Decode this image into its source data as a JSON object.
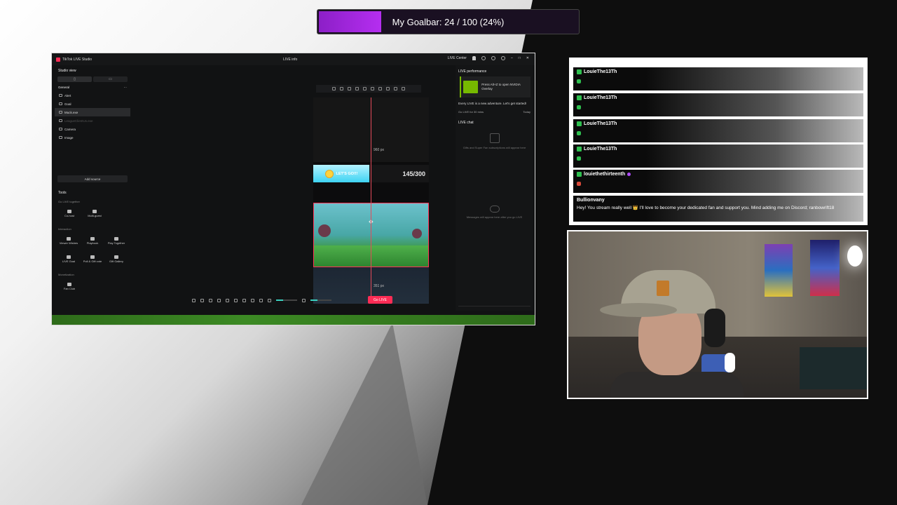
{
  "goalbar": {
    "label": "My Goalbar:",
    "progress_text": "24 / 100 (24%)",
    "progress_fraction": 0.24,
    "fill_color": "#b52ef0"
  },
  "studio": {
    "window_title": "TikTok LIVE Studio",
    "center_title": "LIVE info",
    "live_center": "LIVE Center",
    "studio_view": "Studio view",
    "general_label": "General",
    "sources": [
      {
        "label": "Alert",
        "icon": "alert-icon"
      },
      {
        "label": "Goal",
        "icon": "goal-icon"
      },
      {
        "label": "Muck.exe",
        "icon": "window-icon"
      },
      {
        "label": "LeagueClientUx.exe",
        "icon": "window-icon"
      },
      {
        "label": "Camera",
        "icon": "camera-icon"
      },
      {
        "label": "Image",
        "icon": "image-icon"
      }
    ],
    "add_source": "Add source",
    "tools_label": "Tools",
    "go_live_together": "Go LIVE together",
    "tools_row1": [
      "Co-host",
      "Multi-guest"
    ],
    "interaction_label": "Interaction",
    "tools_row2": [
      "Viewer Wishes",
      "Playbook",
      "Play Together"
    ],
    "tools_row3": [
      "LIVE Goal",
      "Poll & Gift vote",
      "Gift Gallery"
    ],
    "monetization_label": "Monetization",
    "tools_row4": [
      "Fan Club"
    ],
    "canvas": {
      "top_px": "960 px",
      "bottom_px": "351 px",
      "goal_button": "LET'S GO!!!",
      "goal_count": "145/300"
    },
    "go_live_button": "Go LIVE",
    "right_panel": {
      "live_performance": "LIVE performance",
      "nvidia_text": "Press Alt+Z to open NVIDIA Overlay",
      "adventure_text": "Every LIVE is a new adventure. Let's get started!",
      "go_live_for": "Go LIVE for 30 mins",
      "today": "Today",
      "live_chat": "LIVE chat",
      "gifts_empty": "Gifts and Super Fan subscriptions will appear here",
      "messages_empty": "Messages will appear here after you go LIVE"
    }
  },
  "chat": {
    "messages": [
      {
        "user": "LouieThe13Th",
        "text": ""
      },
      {
        "user": "LouieThe13Th",
        "text": ""
      },
      {
        "user": "LouieThe13Th",
        "text": ""
      },
      {
        "user": "LouieThe13Th",
        "text": ""
      },
      {
        "user": "louiethethirteenth",
        "text": ""
      },
      {
        "user": "Bullionvany",
        "text": "Hey! You stream really well 👑 I'll love to become your dedicated fan and support you. Mind adding me on Discord; ranbowrift18"
      }
    ]
  }
}
